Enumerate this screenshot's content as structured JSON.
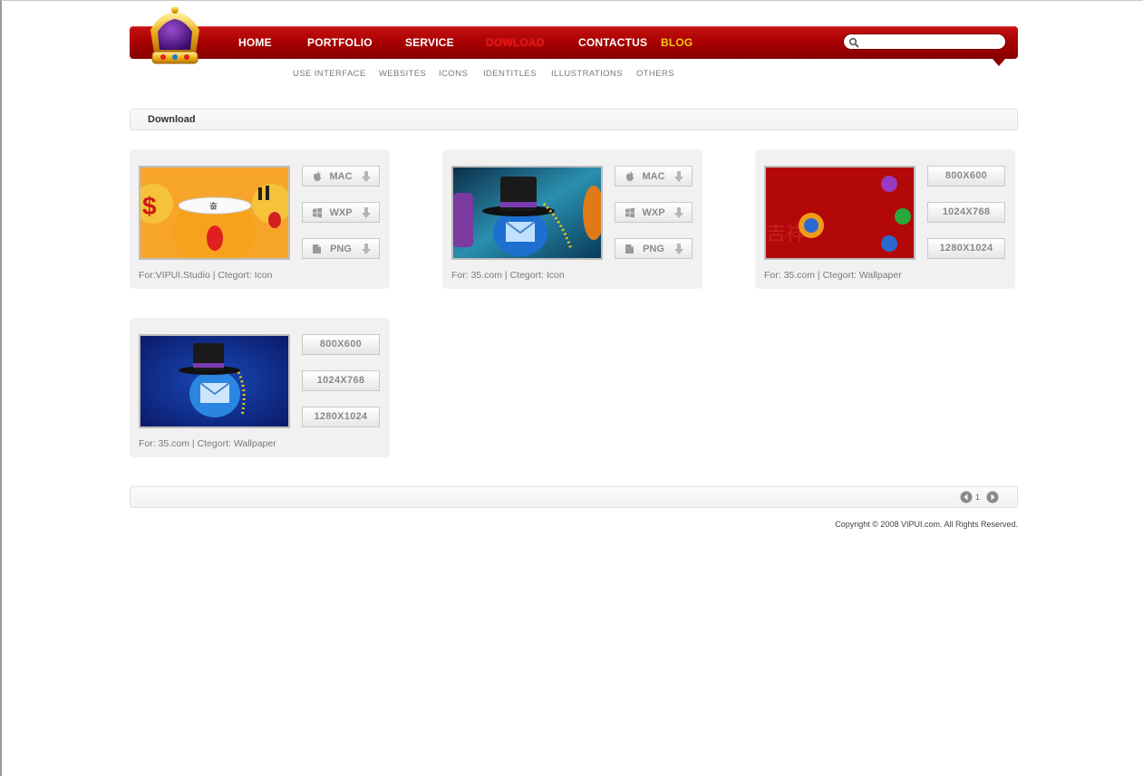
{
  "header": {
    "nav": [
      {
        "label": "HOME",
        "state": "normal"
      },
      {
        "label": "PORTFOLIO",
        "state": "normal"
      },
      {
        "label": "SERVICE",
        "state": "normal"
      },
      {
        "label": "DOWLOAD",
        "state": "active"
      },
      {
        "label": "CONTACTUS",
        "state": "normal"
      },
      {
        "label": "BLOG",
        "state": "highlight"
      }
    ],
    "search": {
      "value": "",
      "placeholder": ""
    },
    "subnav": [
      "USE INTERFACE",
      "WEBSITES",
      "ICONS",
      "IDENTITLES",
      "ILLUSTRATIONS",
      "OTHERS"
    ]
  },
  "breadcrumb": {
    "title": "Download"
  },
  "cards": [
    {
      "caption": "For:VIPUI.Studio | Ctegort: Icon",
      "buttons": [
        {
          "label": "MAC",
          "icon": "apple-icon"
        },
        {
          "label": "WXP",
          "icon": "windows-icon"
        },
        {
          "label": "PNG",
          "icon": "file-icon"
        }
      ]
    },
    {
      "caption": "For: 35.com | Ctegort: Icon",
      "buttons": [
        {
          "label": "MAC",
          "icon": "apple-icon"
        },
        {
          "label": "WXP",
          "icon": "windows-icon"
        },
        {
          "label": "PNG",
          "icon": "file-icon"
        }
      ]
    },
    {
      "caption": "For: 35.com | Ctegort: Wallpaper",
      "buttons": [
        {
          "label": "800X600"
        },
        {
          "label": "1024X768"
        },
        {
          "label": "1280X1024"
        }
      ]
    },
    {
      "caption": "For: 35.com | Ctegort: Wallpaper",
      "buttons": [
        {
          "label": "800X600"
        },
        {
          "label": "1024X768"
        },
        {
          "label": "1280X1024"
        }
      ]
    }
  ],
  "pager": {
    "current": "1"
  },
  "footer": {
    "copyright": "Copyright © 2008 VIPUI.com. All Rights Reserved."
  },
  "colors": {
    "brand_red": "#a40000",
    "active_nav": "#e01010",
    "blog": "#f7c319"
  }
}
